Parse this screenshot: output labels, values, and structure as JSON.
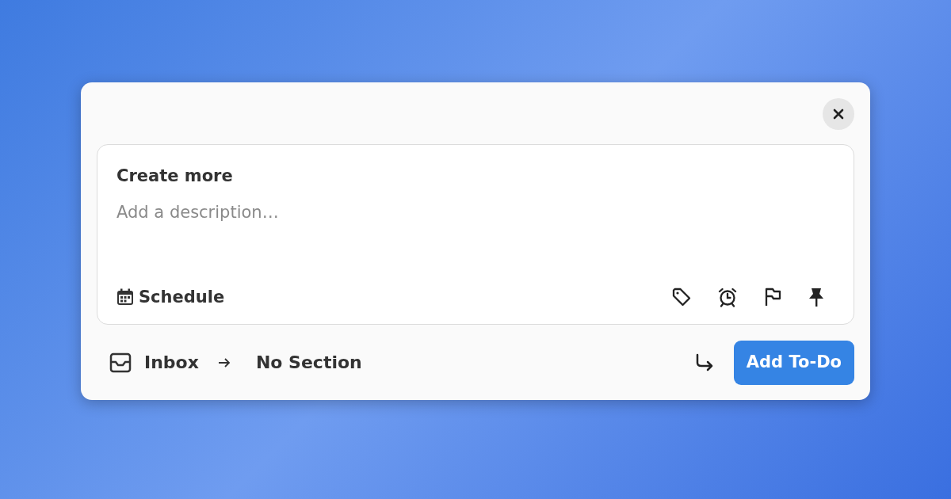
{
  "task_editor": {
    "title": {
      "value": "Create more"
    },
    "description": {
      "placeholder": "Add a description…"
    },
    "schedule_button": {
      "label": "Schedule"
    }
  },
  "footer": {
    "project": "Inbox",
    "section": "No Section",
    "submit_button": "Add To-Do"
  }
}
